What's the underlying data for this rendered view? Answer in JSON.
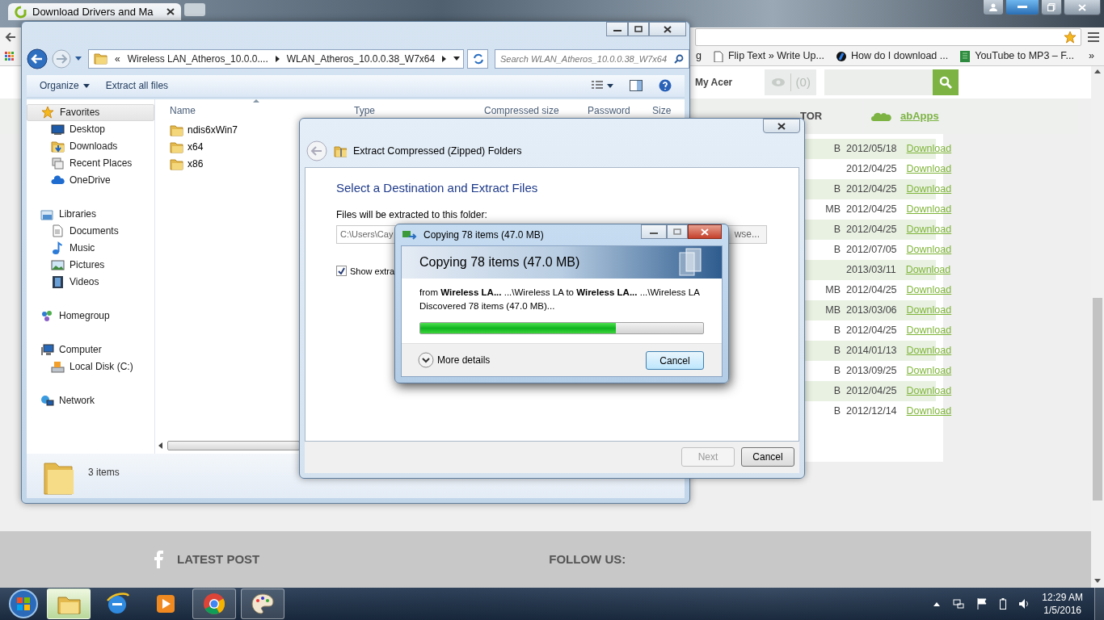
{
  "browser": {
    "tab_title": "Download Drivers and Ma",
    "bookmark_fragment": "g",
    "bookmarks": [
      {
        "kind": "page",
        "label": "Flip Text » Write Up..."
      },
      {
        "kind": "site",
        "label": "How do I download ..."
      },
      {
        "kind": "sheet",
        "label": "YouTube to MP3 – F..."
      }
    ],
    "bookmarks_more": "»"
  },
  "site": {
    "account_link": "My Acer",
    "watch_count": "(0)",
    "nav": [
      {
        "kind": "text",
        "label": "TOR"
      },
      {
        "kind": "apps",
        "label": "abApps"
      }
    ],
    "downloads": [
      {
        "size_fragment": "B",
        "date": "2012/05/18",
        "link": "Download"
      },
      {
        "date": "2012/04/25",
        "link": "Download"
      },
      {
        "size_fragment": "B",
        "date": "2012/04/25",
        "link": "Download"
      },
      {
        "size_fragment": "MB",
        "date": "2012/04/25",
        "link": "Download"
      },
      {
        "size_fragment": "B",
        "date": "2012/04/25",
        "link": "Download"
      },
      {
        "size_fragment": "B",
        "date": "2012/07/05",
        "link": "Download"
      },
      {
        "date": "2013/03/11",
        "link": "Download"
      },
      {
        "size_fragment": "MB",
        "date": "2012/04/25",
        "link": "Download"
      },
      {
        "size_fragment": "MB",
        "date": "2013/03/06",
        "link": "Download"
      },
      {
        "size_fragment": "B",
        "date": "2012/04/25",
        "link": "Download"
      },
      {
        "size_fragment": "B",
        "date": "2014/01/13",
        "link": "Download"
      },
      {
        "size_fragment": "B",
        "date": "2013/09/25",
        "link": "Download"
      },
      {
        "size_fragment": "B",
        "date": "2012/04/25",
        "link": "Download"
      },
      {
        "size_fragment": "B",
        "date": "2012/12/14",
        "link": "Download"
      }
    ],
    "footer": {
      "latest_post": "LATEST POST",
      "follow_us": "FOLLOW US:"
    }
  },
  "explorer": {
    "address_overflow": "«",
    "breadcrumbs": [
      "Wireless LAN_Atheros_10.0.0....",
      "WLAN_Atheros_10.0.0.38_W7x64"
    ],
    "search": {
      "placeholder": "Search WLAN_Atheros_10.0.0.38_W7x64"
    },
    "toolbar": [
      {
        "label": "Organize",
        "dropdown": true
      },
      {
        "label": "Extract all files",
        "dropdown": false
      }
    ],
    "nav": [
      {
        "kind": "star",
        "label": "Favorites",
        "selected": true,
        "children": [
          {
            "kind": "desktop",
            "label": "Desktop",
            "selected": false
          },
          {
            "kind": "downloads",
            "label": "Downloads",
            "selected": false
          },
          {
            "kind": "recent",
            "label": "Recent Places",
            "selected": false
          },
          {
            "kind": "cloud",
            "label": "OneDrive",
            "selected": false
          }
        ]
      },
      {
        "kind": "library",
        "label": "Libraries",
        "selected": false,
        "children": [
          {
            "kind": "document",
            "label": "Documents",
            "selected": false
          },
          {
            "kind": "music",
            "label": "Music",
            "selected": false
          },
          {
            "kind": "pictures",
            "label": "Pictures",
            "selected": false
          },
          {
            "kind": "videos",
            "label": "Videos",
            "selected": false
          }
        ]
      },
      {
        "kind": "homegroup",
        "label": "Homegroup",
        "selected": false
      },
      {
        "kind": "computer",
        "label": "Computer",
        "selected": false,
        "children": [
          {
            "kind": "disk",
            "label": "Local Disk (C:)",
            "selected": false
          }
        ]
      },
      {
        "kind": "network",
        "label": "Network",
        "selected": false
      }
    ],
    "columns": [
      "Name",
      "Type",
      "Compressed size",
      "Password",
      "Size"
    ],
    "files": [
      "ndis6xWin7",
      "x64",
      "x86"
    ],
    "status": "3 items"
  },
  "wizard": {
    "title": "Extract Compressed (Zipped) Folders",
    "heading": "Select a Destination and Extract Files",
    "folder_label": "Files will be extracted to this folder:",
    "folder_path": "C:\\Users\\Cay",
    "browse_fragment": "wse...",
    "show_files": {
      "label": "Show extra",
      "checked": true
    },
    "buttons": [
      {
        "label": "Next",
        "disabled": true
      },
      {
        "label": "Cancel",
        "disabled": false
      }
    ]
  },
  "copy_dialog": {
    "title": "Copying 78 items (47.0 MB)",
    "heading": "Copying 78 items (47.0 MB)",
    "from_line": "from **Wireless LA...** ...\\Wireless LA to **Wireless LA...** ...\\Wireless LA",
    "status": "Discovered 78 items (47.0 MB)...",
    "level": 0.69,
    "details": "More details",
    "cancel": "Cancel"
  },
  "taskbar": {
    "apps": [
      {
        "kind": "explorer",
        "running": true,
        "selected": true
      },
      {
        "kind": "ie",
        "running": false,
        "selected": false
      },
      {
        "kind": "media",
        "running": false,
        "selected": false
      },
      {
        "kind": "chrome",
        "running": true,
        "selected": false
      },
      {
        "kind": "paint",
        "running": true,
        "selected": false
      }
    ],
    "time": "12:29 AM",
    "date": "1/5/2016"
  }
}
